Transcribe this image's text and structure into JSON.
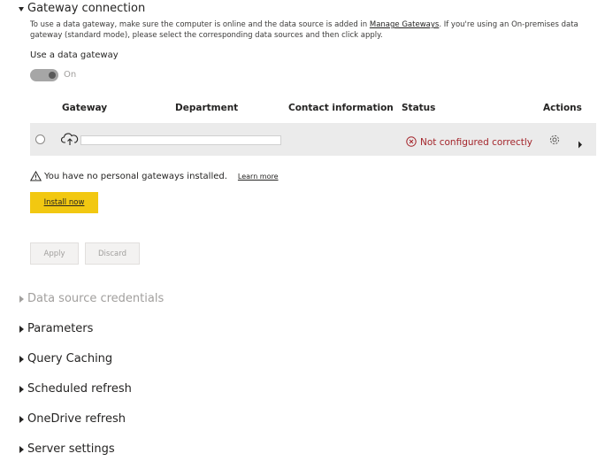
{
  "sections": {
    "gateway_connection": "Gateway connection",
    "data_source_credentials": "Data source credentials",
    "parameters": "Parameters",
    "query_caching": "Query Caching",
    "scheduled_refresh": "Scheduled refresh",
    "onedrive_refresh": "OneDrive refresh",
    "server_settings": "Server settings"
  },
  "gateway": {
    "description_1": "To use a data gateway, make sure the computer is online and the data source is added in ",
    "manage_link": "Manage Gateways",
    "description_2": ". If you're using an On-premises data gateway (standard mode), please select the corresponding data sources and then click apply.",
    "use_gateway_label": "Use a data gateway",
    "toggle_state": "On",
    "table": {
      "headers": [
        "Gateway",
        "Department",
        "Contact information",
        "Status",
        "Actions"
      ],
      "rows": [
        {
          "status": "Not configured correctly"
        }
      ]
    },
    "warning_text": "You have no personal gateways installed.",
    "learn_more": "Learn more",
    "install_button": "Install now",
    "apply_button": "Apply",
    "discard_button": "Discard"
  },
  "colors": {
    "accent_yellow": "#f2c811",
    "error_red": "#a4262c",
    "row_bg": "#ebebeb"
  },
  "icons": {
    "row_gateway": "cloud-upload-icon",
    "status": "error-circle-icon",
    "settings": "gear-icon",
    "expand": "chevron-right-icon",
    "warning": "warning-triangle-icon"
  }
}
